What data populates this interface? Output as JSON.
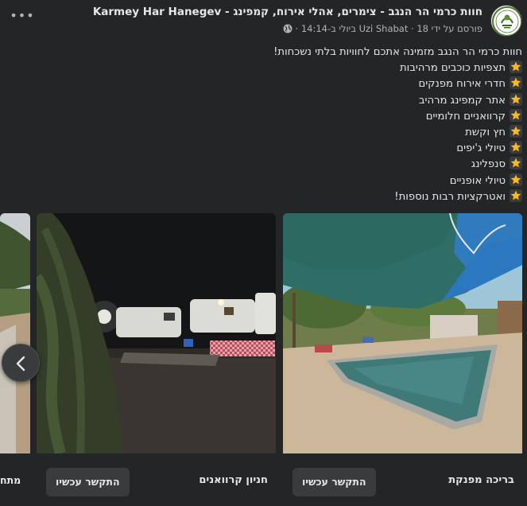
{
  "header": {
    "page_name": "חוות כרמי הר הנגב - צימרים, אהלי אירוח, קמפינג - Karmey Har Hanegev",
    "meta": "פורסם על ידי Uzi Shabat · 18 ביולי ב-14:14 ·",
    "more_label": "•••",
    "avatar_icon": "farm-logo-icon"
  },
  "post": {
    "intro": "חוות כרמי הר הנגב מזמינה אתכם לחוויות בלתי נשכחות!",
    "bullet_icon": "star-emoji-icon",
    "items": [
      "תצפיות כוכבים מרהיבות",
      "חדרי אירוח מפנקים",
      "אתר קמפינג מרהיב",
      "קרוואניים חלומיים",
      "חץ וקשת",
      "טיולי ג'יפים",
      "סנפלינג",
      "טיולי אופניים",
      "ואטרקציות רבות נוספות!"
    ]
  },
  "carousel": {
    "cards": [
      {
        "title": "בריכה מפנקת",
        "cta": "התקשר עכשיו"
      },
      {
        "title": "חניון קרוואנים",
        "cta": "התקשר עכשיו"
      },
      {
        "title": "מתח"
      }
    ],
    "prev_icon": "chevron-left-icon"
  },
  "colors": {
    "background": "#242526",
    "card": "#3a3b3c",
    "text": "#e4e6eb",
    "secondary_text": "#b0b3b8",
    "star": "#f7b928"
  }
}
